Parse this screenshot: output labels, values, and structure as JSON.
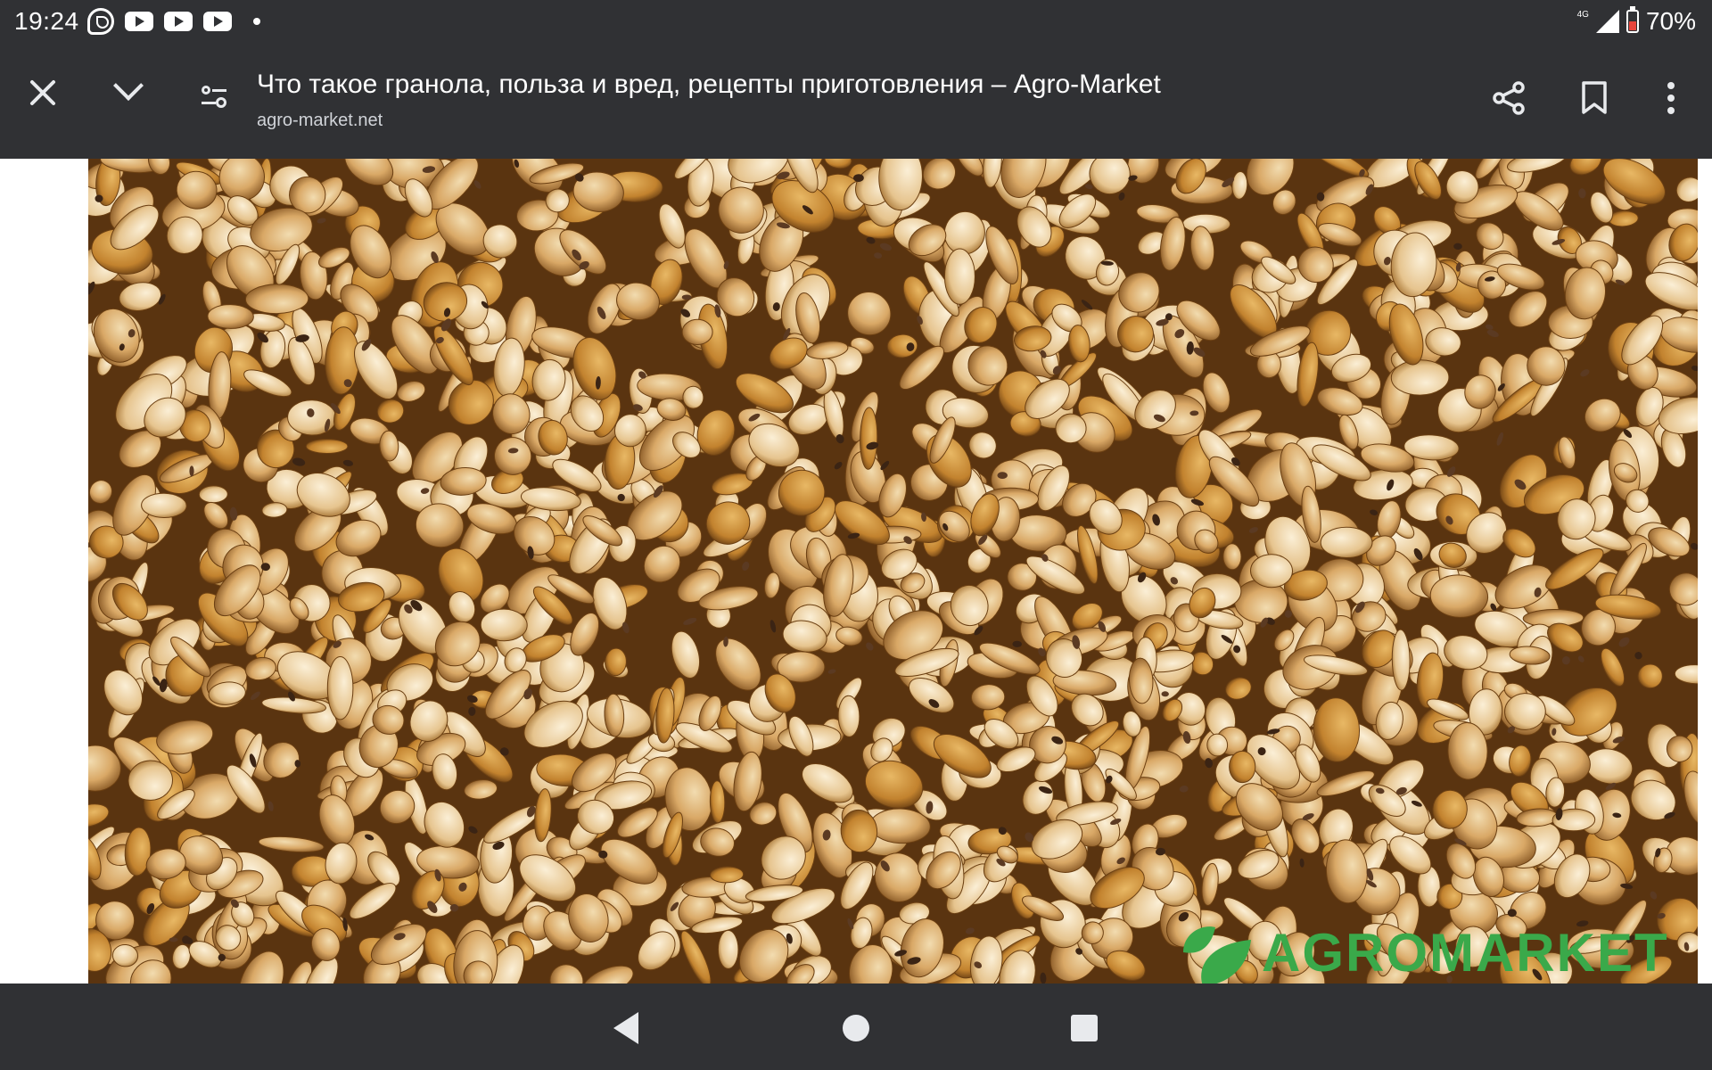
{
  "status_bar": {
    "time": "19:24",
    "network_label": "4G",
    "battery": "70%",
    "left_icons": [
      "viber-icon",
      "youtube-icon",
      "youtube-icon",
      "youtube-icon",
      "notification-dot"
    ],
    "right_icons": [
      "signal-icon",
      "battery-icon"
    ]
  },
  "toolbar": {
    "title": "Что такое гранола, польза и вред, рецепты приготовления – Agro-Market",
    "url": "agro-market.net",
    "icons": [
      "close-icon",
      "chevron-down-icon",
      "page-settings-icon",
      "share-icon",
      "bookmark-icon",
      "more-vert-icon"
    ]
  },
  "content": {
    "image_subject": "granola",
    "watermark": "AGROMARKET"
  },
  "nav_bar": {
    "icons": [
      "back-icon",
      "home-icon",
      "recents-icon"
    ]
  },
  "colors": {
    "chrome_bg": "#303134",
    "chrome_text": "#e8eaed",
    "page_bg": "#ffffff",
    "watermark_green": "#3aa94a",
    "battery_red": "#e8453c"
  }
}
